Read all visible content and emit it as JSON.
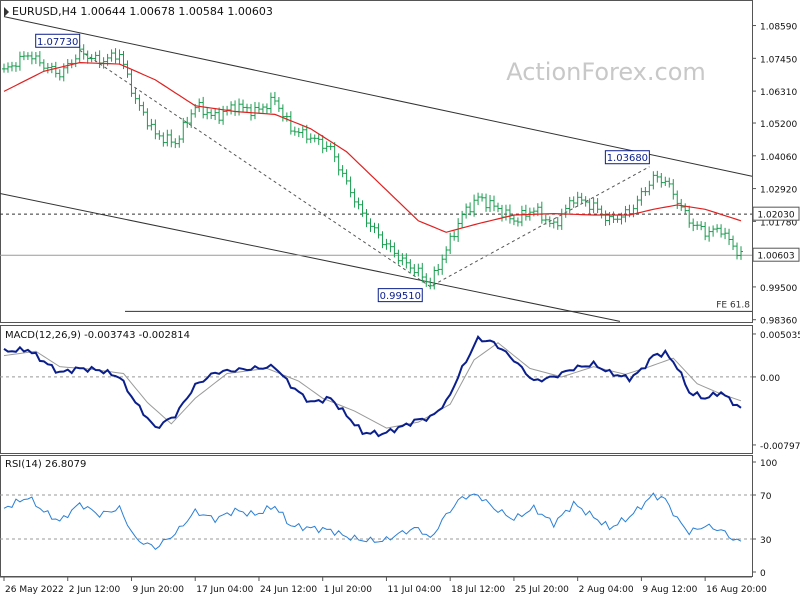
{
  "header": {
    "symbol_info": "EURUSD,H4  1.00644 1.00678 1.00584 1.00603"
  },
  "watermark": "ActionForex.com",
  "colors": {
    "bull_bar": "#1a9c50",
    "bear_bar": "#1a9c50",
    "ma_line": "#e02020",
    "channel_line": "#333333",
    "macd_line": "#0b1f8c",
    "signal_line": "#9a9a9a",
    "rsi_line": "#2a7fd6",
    "label_border": "#0b1f8c"
  },
  "price_panel": {
    "ylim": [
      0.9828,
      1.092
    ],
    "yticks": [
      "1.08590",
      "1.07450",
      "1.06310",
      "1.05200",
      "1.04060",
      "1.02920",
      "1.01780",
      "0.99500",
      "0.98360"
    ],
    "ytick_values": [
      1.0859,
      1.0745,
      1.0631,
      1.052,
      1.0406,
      1.0292,
      1.0178,
      0.995,
      0.9836
    ],
    "current_price_label": "1.00603",
    "current_price": 1.00603,
    "level_label": "1.02030",
    "level_price": 1.0203,
    "annotations": [
      {
        "text": "1.07730",
        "index": 19,
        "price": 1.0773
      },
      {
        "text": "0.99510",
        "index": 107,
        "price": 0.9951
      },
      {
        "text": "1.03680",
        "index": 162,
        "price": 1.0368
      }
    ],
    "fe_label": "FE 61.8",
    "fe_level": 0.9865
  },
  "macd_panel": {
    "label": "MACD(12,26,9) -0.003743 -0.002814",
    "ylim": [
      -0.0088,
      0.0055
    ],
    "yticks": [
      "0.005035",
      "0.00",
      "-0.007973"
    ],
    "ytick_values": [
      0.005035,
      0.0,
      -0.007973
    ]
  },
  "rsi_panel": {
    "label": "RSI(14) 26.8079",
    "ylim": [
      0,
      100
    ],
    "yticks": [
      "100",
      "70",
      "30",
      "0"
    ],
    "ytick_values": [
      100,
      70,
      30,
      0
    ]
  },
  "x_axis": {
    "labels": [
      "26 May 2022",
      "2 Jun 12:00",
      "9 Jun 20:00",
      "17 Jun 04:00",
      "24 Jun 12:00",
      "1 Jul 20:00",
      "11 Jul 04:00",
      "18 Jul 12:00",
      "25 Jul 20:00",
      "2 Aug 04:00",
      "9 Aug 12:00",
      "16 Aug 20:00"
    ],
    "label_indices": [
      0,
      16,
      32,
      48,
      64,
      80,
      96,
      112,
      128,
      144,
      160,
      176
    ]
  },
  "chart_data": {
    "type": "line",
    "title": "EURUSD,H4",
    "xlabel": "",
    "ylabel": "",
    "bar_count": 186,
    "anchors": {
      "price": [
        [
          0,
          1.07
        ],
        [
          6,
          1.076
        ],
        [
          10,
          1.072
        ],
        [
          14,
          1.069
        ],
        [
          19,
          1.0765
        ],
        [
          24,
          1.0735
        ],
        [
          29,
          1.076
        ],
        [
          33,
          1.06
        ],
        [
          38,
          1.048
        ],
        [
          43,
          1.045
        ],
        [
          48,
          1.058
        ],
        [
          53,
          1.054
        ],
        [
          58,
          1.058
        ],
        [
          63,
          1.056
        ],
        [
          68,
          1.06
        ],
        [
          72,
          1.05
        ],
        [
          77,
          1.047
        ],
        [
          82,
          1.043
        ],
        [
          86,
          1.031
        ],
        [
          90,
          1.02
        ],
        [
          95,
          1.011
        ],
        [
          100,
          1.004
        ],
        [
          104,
          1.0
        ],
        [
          107,
          0.996
        ],
        [
          111,
          1.008
        ],
        [
          115,
          1.02
        ],
        [
          119,
          1.026
        ],
        [
          123,
          1.023
        ],
        [
          128,
          1.018
        ],
        [
          133,
          1.022
        ],
        [
          138,
          1.016
        ],
        [
          143,
          1.026
        ],
        [
          148,
          1.023
        ],
        [
          152,
          1.018
        ],
        [
          157,
          1.021
        ],
        [
          160,
          1.027
        ],
        [
          163,
          1.033
        ],
        [
          166,
          1.032
        ],
        [
          169,
          1.025
        ],
        [
          172,
          1.018
        ],
        [
          176,
          1.014
        ],
        [
          180,
          1.015
        ],
        [
          183,
          1.009
        ],
        [
          185,
          1.006
        ]
      ],
      "ma": [
        [
          0,
          1.063
        ],
        [
          10,
          1.07
        ],
        [
          19,
          1.073
        ],
        [
          29,
          1.0725
        ],
        [
          38,
          1.067
        ],
        [
          48,
          1.058
        ],
        [
          58,
          1.056
        ],
        [
          68,
          1.055
        ],
        [
          77,
          1.05
        ],
        [
          86,
          1.042
        ],
        [
          95,
          1.03
        ],
        [
          104,
          1.018
        ],
        [
          111,
          1.014
        ],
        [
          119,
          1.017
        ],
        [
          128,
          1.02
        ],
        [
          138,
          1.0205
        ],
        [
          148,
          1.02
        ],
        [
          157,
          1.02
        ],
        [
          163,
          1.022
        ],
        [
          169,
          1.0235
        ],
        [
          176,
          1.022
        ],
        [
          185,
          1.018
        ]
      ],
      "macd": [
        [
          0,
          0.003
        ],
        [
          6,
          0.0032
        ],
        [
          10,
          0.0018
        ],
        [
          14,
          0.0005
        ],
        [
          19,
          0.001
        ],
        [
          24,
          0.0008
        ],
        [
          29,
          0.0
        ],
        [
          33,
          -0.003
        ],
        [
          38,
          -0.006
        ],
        [
          43,
          -0.0045
        ],
        [
          48,
          -0.001
        ],
        [
          53,
          0.0005
        ],
        [
          58,
          0.0008
        ],
        [
          63,
          0.001
        ],
        [
          68,
          0.0012
        ],
        [
          72,
          -0.001
        ],
        [
          77,
          -0.003
        ],
        [
          82,
          -0.0025
        ],
        [
          86,
          -0.0045
        ],
        [
          90,
          -0.0065
        ],
        [
          95,
          -0.0067
        ],
        [
          100,
          -0.0058
        ],
        [
          104,
          -0.005
        ],
        [
          107,
          -0.0048
        ],
        [
          111,
          -0.003
        ],
        [
          115,
          0.001
        ],
        [
          119,
          0.0045
        ],
        [
          123,
          0.004
        ],
        [
          128,
          0.002
        ],
        [
          133,
          -0.0005
        ],
        [
          138,
          0.0
        ],
        [
          143,
          0.001
        ],
        [
          148,
          0.0015
        ],
        [
          152,
          0.0005
        ],
        [
          157,
          -0.0002
        ],
        [
          160,
          0.0008
        ],
        [
          163,
          0.0025
        ],
        [
          166,
          0.0028
        ],
        [
          169,
          0.0012
        ],
        [
          172,
          -0.0018
        ],
        [
          176,
          -0.0025
        ],
        [
          180,
          -0.0018
        ],
        [
          183,
          -0.003
        ],
        [
          185,
          -0.0037
        ]
      ],
      "signal": [
        [
          0,
          0.0025
        ],
        [
          8,
          0.003
        ],
        [
          14,
          0.0012
        ],
        [
          22,
          0.0009
        ],
        [
          30,
          0.0004
        ],
        [
          36,
          -0.003
        ],
        [
          42,
          -0.0055
        ],
        [
          48,
          -0.0025
        ],
        [
          56,
          0.0004
        ],
        [
          66,
          0.001
        ],
        [
          74,
          -0.0005
        ],
        [
          80,
          -0.0025
        ],
        [
          88,
          -0.004
        ],
        [
          96,
          -0.006
        ],
        [
          104,
          -0.0053
        ],
        [
          112,
          -0.0032
        ],
        [
          118,
          0.002
        ],
        [
          124,
          0.004
        ],
        [
          132,
          0.001
        ],
        [
          140,
          0.0
        ],
        [
          148,
          0.0012
        ],
        [
          156,
          0.0003
        ],
        [
          162,
          0.0012
        ],
        [
          168,
          0.0022
        ],
        [
          174,
          -0.0008
        ],
        [
          180,
          -0.002
        ],
        [
          185,
          -0.0028
        ]
      ],
      "rsi": [
        [
          0,
          58
        ],
        [
          6,
          68
        ],
        [
          10,
          55
        ],
        [
          14,
          46
        ],
        [
          19,
          62
        ],
        [
          24,
          52
        ],
        [
          29,
          58
        ],
        [
          33,
          30
        ],
        [
          38,
          22
        ],
        [
          43,
          35
        ],
        [
          48,
          55
        ],
        [
          53,
          48
        ],
        [
          58,
          56
        ],
        [
          63,
          52
        ],
        [
          68,
          60
        ],
        [
          72,
          42
        ],
        [
          77,
          40
        ],
        [
          82,
          38
        ],
        [
          86,
          32
        ],
        [
          90,
          29
        ],
        [
          95,
          28
        ],
        [
          100,
          36
        ],
        [
          104,
          40
        ],
        [
          107,
          30
        ],
        [
          111,
          52
        ],
        [
          115,
          68
        ],
        [
          119,
          70
        ],
        [
          123,
          58
        ],
        [
          128,
          48
        ],
        [
          133,
          58
        ],
        [
          138,
          44
        ],
        [
          143,
          62
        ],
        [
          148,
          50
        ],
        [
          152,
          40
        ],
        [
          157,
          50
        ],
        [
          160,
          60
        ],
        [
          163,
          70
        ],
        [
          166,
          66
        ],
        [
          169,
          48
        ],
        [
          172,
          36
        ],
        [
          176,
          42
        ],
        [
          180,
          38
        ],
        [
          183,
          30
        ],
        [
          185,
          27
        ]
      ]
    }
  }
}
